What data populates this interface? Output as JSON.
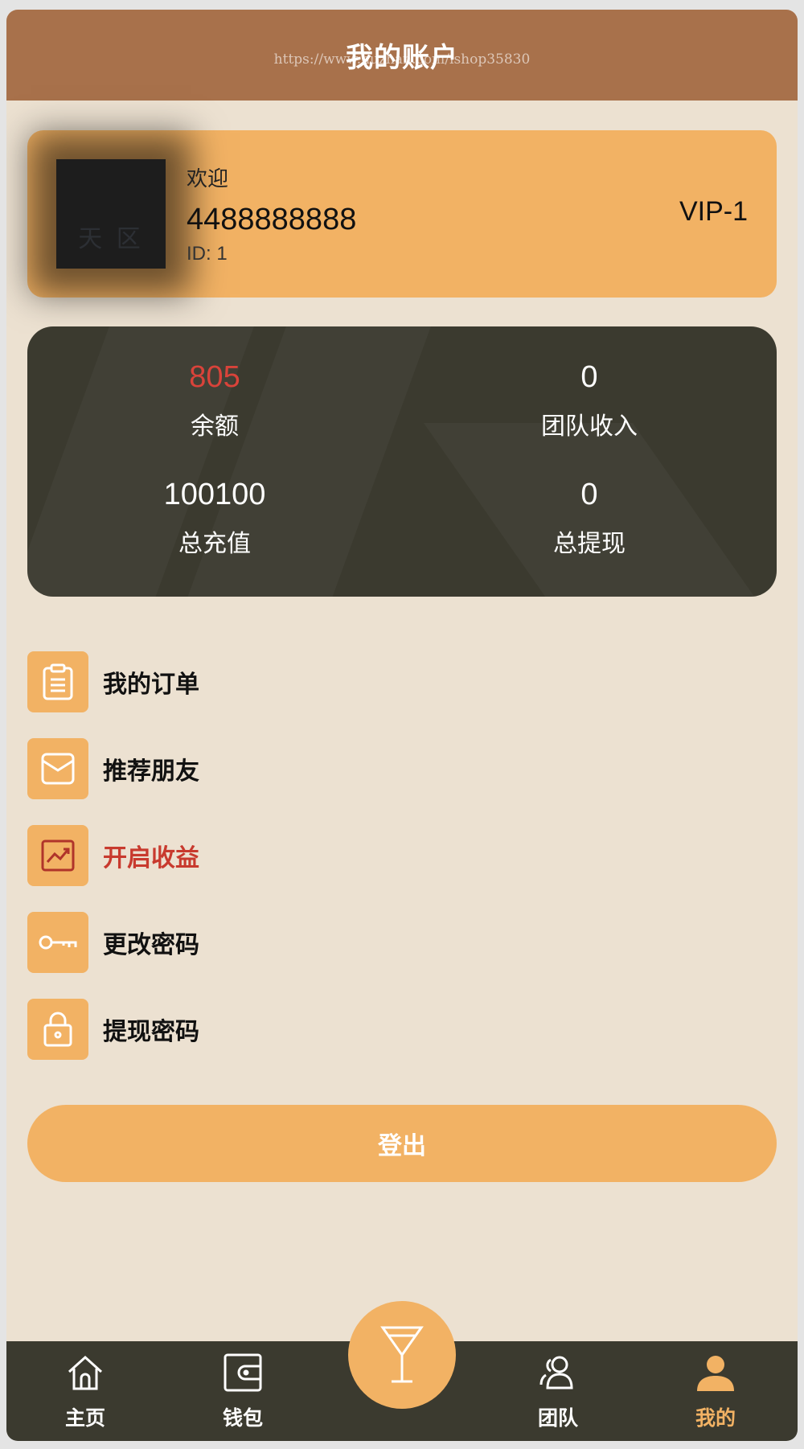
{
  "header": {
    "title": "我的账户",
    "watermark": "https://www.huzhan.com/ishop35830"
  },
  "profile": {
    "avatar_text": "天 区",
    "welcome": "欢迎",
    "phone": "4488888888",
    "id": "ID: 1",
    "vip": "VIP-1"
  },
  "stats": [
    {
      "value": "805",
      "label": "余额",
      "color": "#d9433a"
    },
    {
      "value": "0",
      "label": "团队收入"
    },
    {
      "value": "100100",
      "label": "总充值"
    },
    {
      "value": "0",
      "label": "总提现"
    }
  ],
  "menu": [
    {
      "label": "我的订单",
      "icon": "clipboard-icon"
    },
    {
      "label": "推荐朋友",
      "icon": "envelope-box-icon"
    },
    {
      "label": "开启收益",
      "icon": "chart-trend-icon",
      "highlight": true
    },
    {
      "label": "更改密码",
      "icon": "key-icon"
    },
    {
      "label": "提现密码",
      "icon": "lock-icon"
    }
  ],
  "logout_label": "登出",
  "tabs": [
    {
      "label": "主页",
      "icon": "home-icon"
    },
    {
      "label": "钱包",
      "icon": "wallet-icon"
    },
    {
      "label": "",
      "icon": "cocktail-icon"
    },
    {
      "label": "团队",
      "icon": "team-icon"
    },
    {
      "label": "我的",
      "icon": "user-icon",
      "active": true
    }
  ],
  "colors": {
    "brand": "#f2b264",
    "header": "#a8714b",
    "dark": "#3b3a2f",
    "background": "#ece1d1",
    "highlight": "#c83a2e"
  }
}
